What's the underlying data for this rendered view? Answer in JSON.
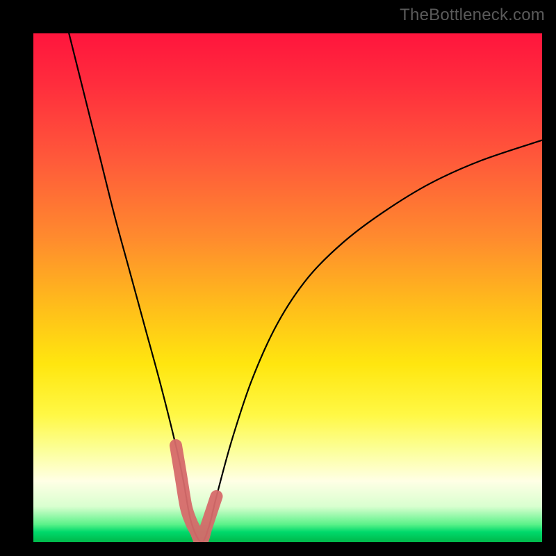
{
  "watermark": "TheBottleneck.com",
  "chart_data": {
    "type": "line",
    "title": "",
    "xlabel": "",
    "ylabel": "",
    "xlim": [
      0,
      100
    ],
    "ylim": [
      0,
      100
    ],
    "grid": false,
    "legend": false,
    "annotations": [],
    "series": [
      {
        "name": "bottleneck-curve",
        "style": "thin-black",
        "x": [
          7,
          10,
          13,
          16,
          19,
          22,
          25,
          28,
          29.5,
          31,
          33,
          34.5,
          36,
          39,
          43,
          48,
          54,
          61,
          69,
          78,
          88,
          100
        ],
        "y": [
          100,
          88,
          76,
          64,
          53,
          42,
          31,
          19,
          12,
          4,
          0,
          3,
          9,
          20,
          32,
          43,
          52,
          59,
          65,
          70.5,
          75,
          79
        ]
      },
      {
        "name": "highlight-region",
        "style": "thick-salmon",
        "x": [
          28,
          29,
          30,
          31,
          32,
          33,
          34,
          35,
          36
        ],
        "y": [
          19,
          13,
          7,
          4,
          2,
          0,
          3,
          6,
          9
        ]
      }
    ],
    "background_gradient": {
      "top": "#ff153d",
      "middle": "#ffe60f",
      "bottom": "#00b84a"
    }
  }
}
